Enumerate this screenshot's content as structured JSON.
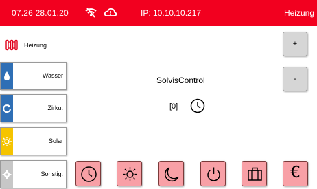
{
  "status_bar": {
    "time": "07.26 28.01.20",
    "wifi_icon": "wifi-off-icon",
    "cloud_icon": "cloud-alert-icon",
    "ip": "IP: 10.10.10.217",
    "mode": "Heizung",
    "color": "#f2001f"
  },
  "sidebar": {
    "heizung_label": "Heizung",
    "items": [
      {
        "label": "Wasser",
        "icon": "water-drop-icon",
        "color": "#2f6fb5"
      },
      {
        "label": "Zirku.",
        "icon": "circulation-icon",
        "color": "#2f6fb5"
      },
      {
        "label": "Solar",
        "icon": "sun-icon",
        "color": "#f5c400"
      },
      {
        "label": "Sonstig.",
        "icon": "gear-icon",
        "color": "#c7c7c7"
      }
    ]
  },
  "main": {
    "title": "SolvisControl",
    "counter": "[0]",
    "clock_icon": "clock-icon"
  },
  "controls": {
    "plus_label": "+",
    "minus_label": "-"
  },
  "mode_buttons": [
    {
      "icon": "clock-icon"
    },
    {
      "icon": "sun-icon"
    },
    {
      "icon": "moon-icon"
    },
    {
      "icon": "power-icon"
    },
    {
      "icon": "suitcase-icon"
    },
    {
      "icon": "euro-icon",
      "glyph": "€"
    }
  ],
  "mode_button_color": "#f8a0a6"
}
